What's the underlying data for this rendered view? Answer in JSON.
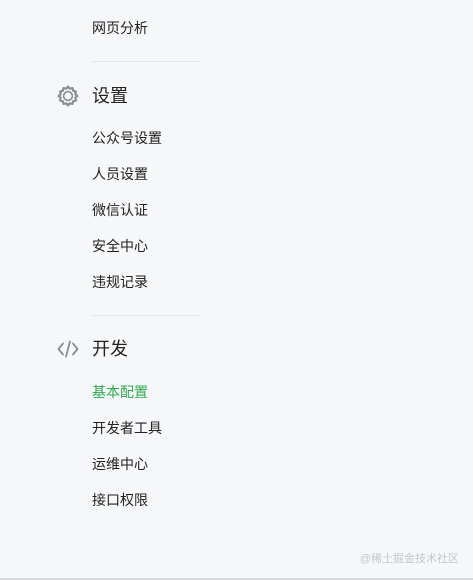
{
  "top_items": [
    {
      "label": "网页分析"
    }
  ],
  "sections": [
    {
      "icon": "gear-icon",
      "title": "设置",
      "items": [
        {
          "label": "公众号设置",
          "active": false
        },
        {
          "label": "人员设置",
          "active": false
        },
        {
          "label": "微信认证",
          "active": false
        },
        {
          "label": "安全中心",
          "active": false
        },
        {
          "label": "违规记录",
          "active": false
        }
      ]
    },
    {
      "icon": "code-icon",
      "title": "开发",
      "items": [
        {
          "label": "基本配置",
          "active": true
        },
        {
          "label": "开发者工具",
          "active": false
        },
        {
          "label": "运维中心",
          "active": false
        },
        {
          "label": "接口权限",
          "active": false
        }
      ]
    }
  ],
  "watermark": "@稀土掘金技术社区",
  "colors": {
    "active": "#2fa84f",
    "text": "#222222",
    "icon": "#8a8d93",
    "background": "#f6f7f9"
  }
}
